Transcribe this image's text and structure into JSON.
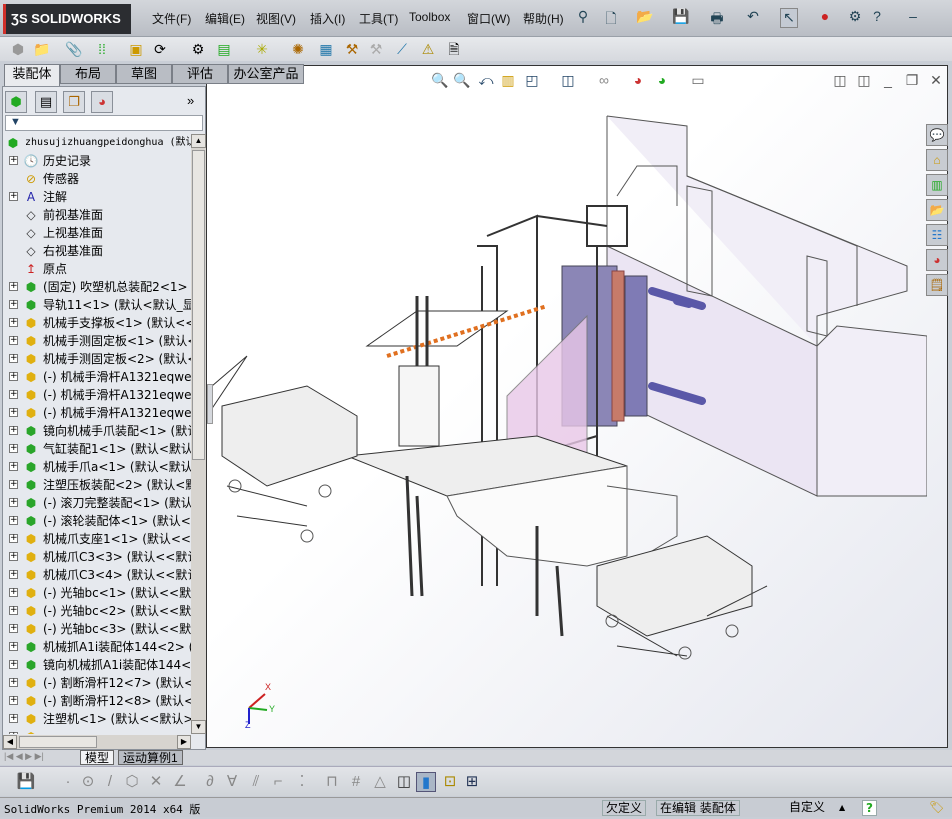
{
  "app": {
    "logo": "SOLIDWORKS"
  },
  "menu": [
    "文件(F)",
    "编辑(E)",
    "视图(V)",
    "插入(I)",
    "工具(T)",
    "Toolbox",
    "窗口(W)",
    "帮助(H)"
  ],
  "quick_access": {
    "icons": [
      "new-icon",
      "open-icon",
      "save-icon",
      "print-icon",
      "undo-icon",
      "select-icon",
      "rebuild-icon",
      "options-icon",
      "help-icon"
    ],
    "help_label": "?"
  },
  "command_tabs": [
    {
      "label": "装配体",
      "active": true
    },
    {
      "label": "布局"
    },
    {
      "label": "草图"
    },
    {
      "label": "评估"
    },
    {
      "label": "办公室产品"
    }
  ],
  "feature_manager": {
    "filter_icon": "▼",
    "root": "zhusujizhuangpeidonghua  (默认<显示状态-1>)",
    "items": [
      {
        "label": "历史记录",
        "type": "history",
        "expand": true
      },
      {
        "label": "传感器",
        "type": "sensor",
        "expand": false
      },
      {
        "label": "注解",
        "type": "annotation",
        "expand": true
      },
      {
        "label": "前视基准面",
        "type": "plane",
        "expand": false
      },
      {
        "label": "上视基准面",
        "type": "plane",
        "expand": false
      },
      {
        "label": "右视基准面",
        "type": "plane",
        "expand": false
      },
      {
        "label": "原点",
        "type": "origin",
        "expand": false
      },
      {
        "label": "(固定) 吹塑机总装配2<1>",
        "type": "assembly",
        "expand": true
      },
      {
        "label": "导轨11<1> (默认<默认_显示",
        "type": "assembly",
        "expand": true
      },
      {
        "label": "机械手支撑板<1> (默认<<默",
        "type": "part",
        "expand": true
      },
      {
        "label": "机械手测固定板<1> (默认<<",
        "type": "part",
        "expand": true
      },
      {
        "label": "机械手测固定板<2> (默认<<",
        "type": "part",
        "expand": true
      },
      {
        "label": "(-) 机械手滑杆A1321eqwe2<",
        "type": "part",
        "expand": true
      },
      {
        "label": "(-) 机械手滑杆A1321eqwe2<",
        "type": "part",
        "expand": true
      },
      {
        "label": "(-) 机械手滑杆A1321eqwe2<",
        "type": "part",
        "expand": true
      },
      {
        "label": "镜向机械手爪装配<1> (默认",
        "type": "assembly",
        "expand": true
      },
      {
        "label": "气缸装配1<1> (默认<默认_显",
        "type": "assembly",
        "expand": true
      },
      {
        "label": "机械手爪a<1> (默认<默认_显",
        "type": "assembly",
        "expand": true
      },
      {
        "label": "注塑压板装配<2> (默认<默认",
        "type": "assembly",
        "expand": true
      },
      {
        "label": "(-) 滚刀完整装配<1> (默认",
        "type": "assembly",
        "expand": true
      },
      {
        "label": "(-) 滚轮装配体<1> (默认<默",
        "type": "assembly",
        "expand": true
      },
      {
        "label": "机械爪支座1<1> (默认<<默认",
        "type": "part",
        "expand": true
      },
      {
        "label": "机械爪C3<3> (默认<<默认>_",
        "type": "part",
        "expand": true
      },
      {
        "label": "机械爪C3<4> (默认<<默认>_",
        "type": "part",
        "expand": true
      },
      {
        "label": "(-) 光轴bc<1> (默认<<默认",
        "type": "part",
        "expand": true
      },
      {
        "label": "(-) 光轴bc<2> (默认<<默认",
        "type": "part",
        "expand": true
      },
      {
        "label": "(-) 光轴bc<3> (默认<<默认",
        "type": "part",
        "expand": true
      },
      {
        "label": "机械抓A1i装配体144<2> (默",
        "type": "assembly",
        "expand": true
      },
      {
        "label": "镜向机械抓A1i装配体144<4>",
        "type": "assembly",
        "expand": true
      },
      {
        "label": "(-) 割断滑杆12<7> (默认<<",
        "type": "part",
        "expand": true
      },
      {
        "label": "(-) 割断滑杆12<8> (默认<<",
        "type": "part",
        "expand": true
      },
      {
        "label": "注塑机<1> (默认<<默认>_显",
        "type": "part",
        "expand": true
      },
      {
        "label": "",
        "type": "part",
        "expand": true
      }
    ]
  },
  "bottom_tabs": [
    {
      "label": "模型",
      "active": true
    },
    {
      "label": "运动算例1"
    }
  ],
  "status": {
    "product": "SolidWorks Premium 2014 x64 版",
    "definition": "欠定义",
    "editing": "在编辑 装配体",
    "units": "自定义",
    "units_arrow": "▲",
    "help": "?"
  },
  "triad": {
    "x": "X",
    "y": "Y",
    "z": "Z"
  },
  "colors": {
    "accent": "#d0302a",
    "part_icon": "#f0c020",
    "assembly_icon": "#2aa52a"
  }
}
